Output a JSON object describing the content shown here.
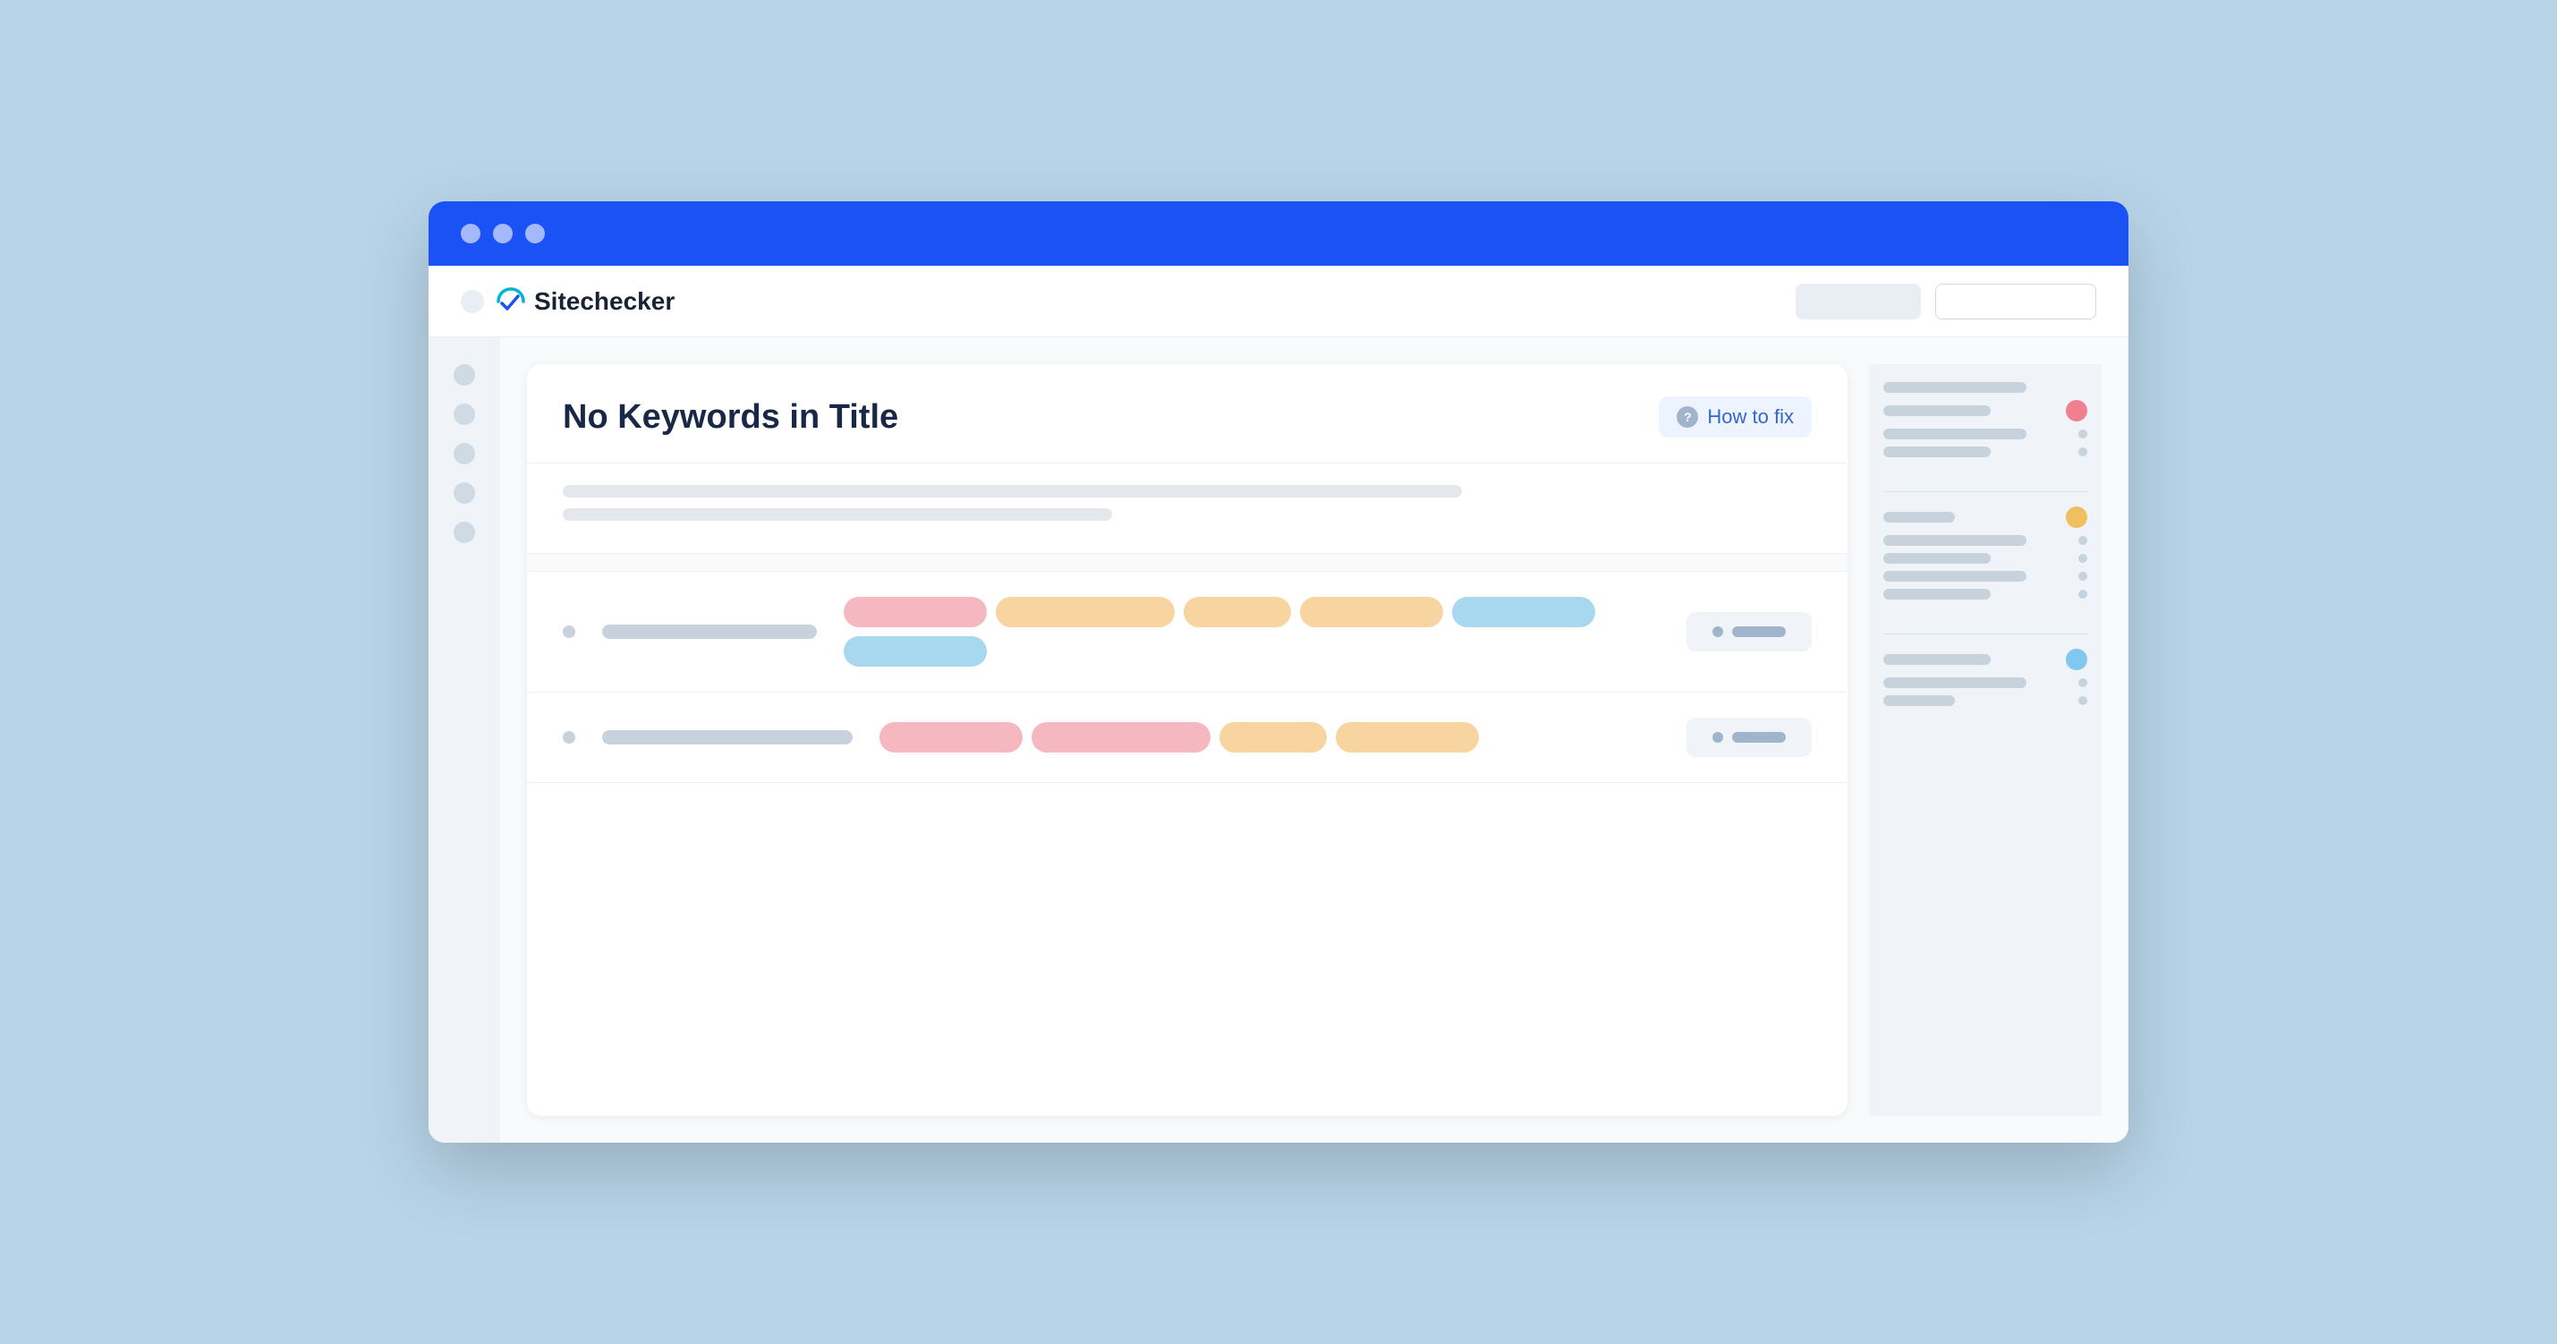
{
  "browser": {
    "title": "Sitechecker",
    "traffic_lights": [
      "",
      "",
      ""
    ]
  },
  "logo": {
    "text": "Sitechecker"
  },
  "toolbar": {
    "btn1_label": "",
    "btn2_label": ""
  },
  "card": {
    "title": "No Keywords in Title",
    "how_to_fix_label": "How to fix"
  },
  "rows": [
    {
      "tags": [
        {
          "color": "pink",
          "size": "md"
        },
        {
          "color": "orange",
          "size": "lg"
        },
        {
          "color": "orange",
          "size": "sm"
        },
        {
          "color": "orange",
          "size": "md"
        },
        {
          "color": "blue",
          "size": "md"
        },
        {
          "color": "blue",
          "size": "md"
        }
      ]
    },
    {
      "tags": [
        {
          "color": "pink",
          "size": "md"
        },
        {
          "color": "pink",
          "size": "lg"
        },
        {
          "color": "orange",
          "size": "sm"
        },
        {
          "color": "orange",
          "size": "md"
        }
      ]
    }
  ],
  "right_sidebar": {
    "sections": [
      {
        "items": [
          {
            "line": "long",
            "badge": "none"
          },
          {
            "line": "medium",
            "badge": "red"
          },
          {
            "line": "short",
            "badge": "dot-gray"
          },
          {
            "line": "medium",
            "badge": "dot-gray"
          }
        ]
      },
      {
        "items": [
          {
            "line": "medium",
            "badge": "orange"
          },
          {
            "line": "long",
            "badge": "dot-gray"
          },
          {
            "line": "medium",
            "badge": "dot-gray"
          },
          {
            "line": "short",
            "badge": "dot-gray"
          },
          {
            "line": "medium",
            "badge": "dot-gray"
          }
        ]
      },
      {
        "items": [
          {
            "line": "medium",
            "badge": "blue"
          },
          {
            "line": "medium",
            "badge": "dot-gray"
          },
          {
            "line": "short",
            "badge": "dot-gray"
          }
        ]
      }
    ]
  }
}
